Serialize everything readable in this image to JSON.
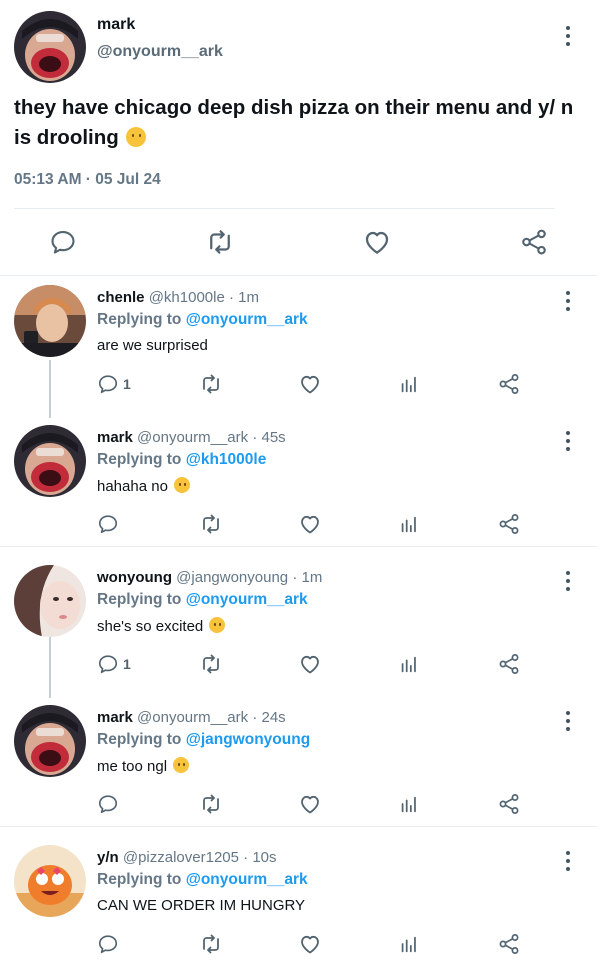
{
  "main_tweet": {
    "author_name": "mark",
    "author_handle": "@onyourm__ark",
    "text": "they have chicago deep dish pizza on their menu and y/ n is drooling",
    "timestamp": "05:13 AM · 05 Jul 24",
    "actions": [
      "reply-icon",
      "retweet-icon",
      "like-icon",
      "share-icon"
    ]
  },
  "replies": [
    {
      "name": "chenle",
      "handle": "@kh1000le",
      "time": "· 1m",
      "replying_label": "Replying to",
      "replying_to": "@onyourm__ark",
      "text": "are we surprised",
      "reply_count": "1",
      "avatar_bg": "#6a4b3b"
    },
    {
      "name": "mark",
      "handle": "@onyourm__ark",
      "time": "· 45s",
      "replying_label": "Replying to",
      "replying_to": "@kh1000le",
      "text": "hahaha no",
      "reply_count": "",
      "avatar_bg": "#2e2a33"
    },
    {
      "name": "wonyoung",
      "handle": "@jangwonyoung",
      "time": "· 1m",
      "replying_label": "Replying to",
      "replying_to": "@onyourm__ark",
      "text": "she's so excited",
      "reply_count": "1",
      "avatar_bg": "#e9d8d2"
    },
    {
      "name": "mark",
      "handle": "@onyourm__ark",
      "time": "· 24s",
      "replying_label": "Replying to",
      "replying_to": "@jangwonyoung",
      "text": "me too ngl",
      "reply_count": "",
      "avatar_bg": "#2e2a33"
    },
    {
      "name": "y/n",
      "handle": "@pizzalover1205",
      "time": "· 10s",
      "replying_label": "Replying to",
      "replying_to": "@onyourm__ark",
      "text": "CAN WE ORDER IM HUNGRY",
      "reply_count": "",
      "avatar_bg": "#f0a24a"
    }
  ],
  "colors": {
    "link": "#1d9bf0",
    "muted": "#657786",
    "icon": "#536471",
    "divider": "#e6ecf0"
  }
}
